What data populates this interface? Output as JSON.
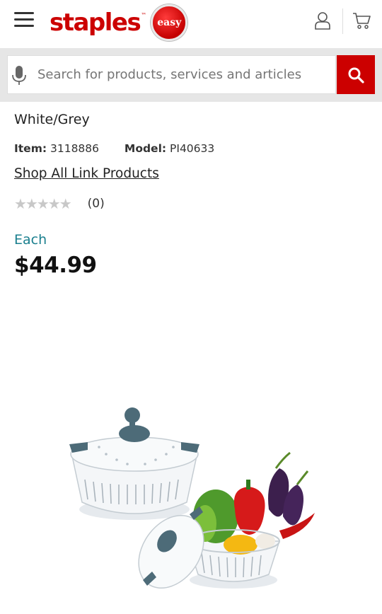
{
  "header": {
    "logo_text": "staples",
    "logo_tm": "™",
    "logo_badge": "easy",
    "menu_icon": "hamburger-menu-icon",
    "account_icon": "person-icon",
    "cart_icon": "cart-icon"
  },
  "search": {
    "placeholder": "Search for products, services and articles",
    "value": "",
    "mic_icon": "microphone-icon",
    "button_icon": "search-icon"
  },
  "product": {
    "variant": "White/Grey",
    "item_label": "Item:",
    "item_value": "3118886",
    "model_label": "Model:",
    "model_value": "PI40633",
    "shop_link": "Shop All Link Products",
    "stars": "★★★★★",
    "rating": 0,
    "review_count": "(0)",
    "unit": "Each",
    "price": "$44.99"
  },
  "colors": {
    "brand_red": "#cc0000",
    "teal": "#1a7f8e"
  }
}
